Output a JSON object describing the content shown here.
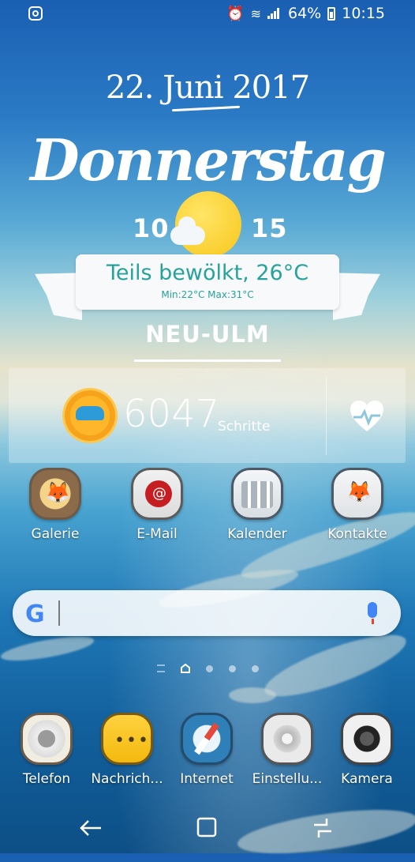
{
  "status_bar": {
    "battery": "64%",
    "time": "10:15",
    "icons": [
      "instagram-icon",
      "alarm-icon",
      "wifi-icon",
      "signal-icon",
      "battery-icon"
    ]
  },
  "weather_widget": {
    "date_day": "22.",
    "date_month": "Juni",
    "date_year": "2017",
    "weekday": "Donnerstag",
    "time_hours": "10",
    "time_minutes": "15",
    "condition": "Teils bewölkt, 26°C",
    "minmax": "Min:22°C Max:31°C",
    "city": "NEU-ULM",
    "icon": "partly-cloudy-icon"
  },
  "steps_widget": {
    "count": "6047",
    "label": "Schritte",
    "icons": [
      "shoe-icon",
      "heart-rate-icon"
    ]
  },
  "apps_row": [
    {
      "label": "Galerie",
      "icon": "gallery-icon"
    },
    {
      "label": "E-Mail",
      "icon": "email-icon"
    },
    {
      "label": "Kalender",
      "icon": "calendar-icon"
    },
    {
      "label": "Kontakte",
      "icon": "contacts-icon"
    }
  ],
  "search": {
    "logo": "G",
    "placeholder": ""
  },
  "dock": [
    {
      "label": "Telefon",
      "icon": "phone-icon"
    },
    {
      "label": "Nachrich...",
      "icon": "messages-icon"
    },
    {
      "label": "Internet",
      "icon": "browser-icon"
    },
    {
      "label": "Einstellu...",
      "icon": "settings-icon"
    },
    {
      "label": "Kamera",
      "icon": "camera-icon"
    }
  ],
  "colors": {
    "accent_teal": "#27a29a",
    "sun_yellow": "#f8c61a",
    "google_blue": "#4285f4"
  }
}
